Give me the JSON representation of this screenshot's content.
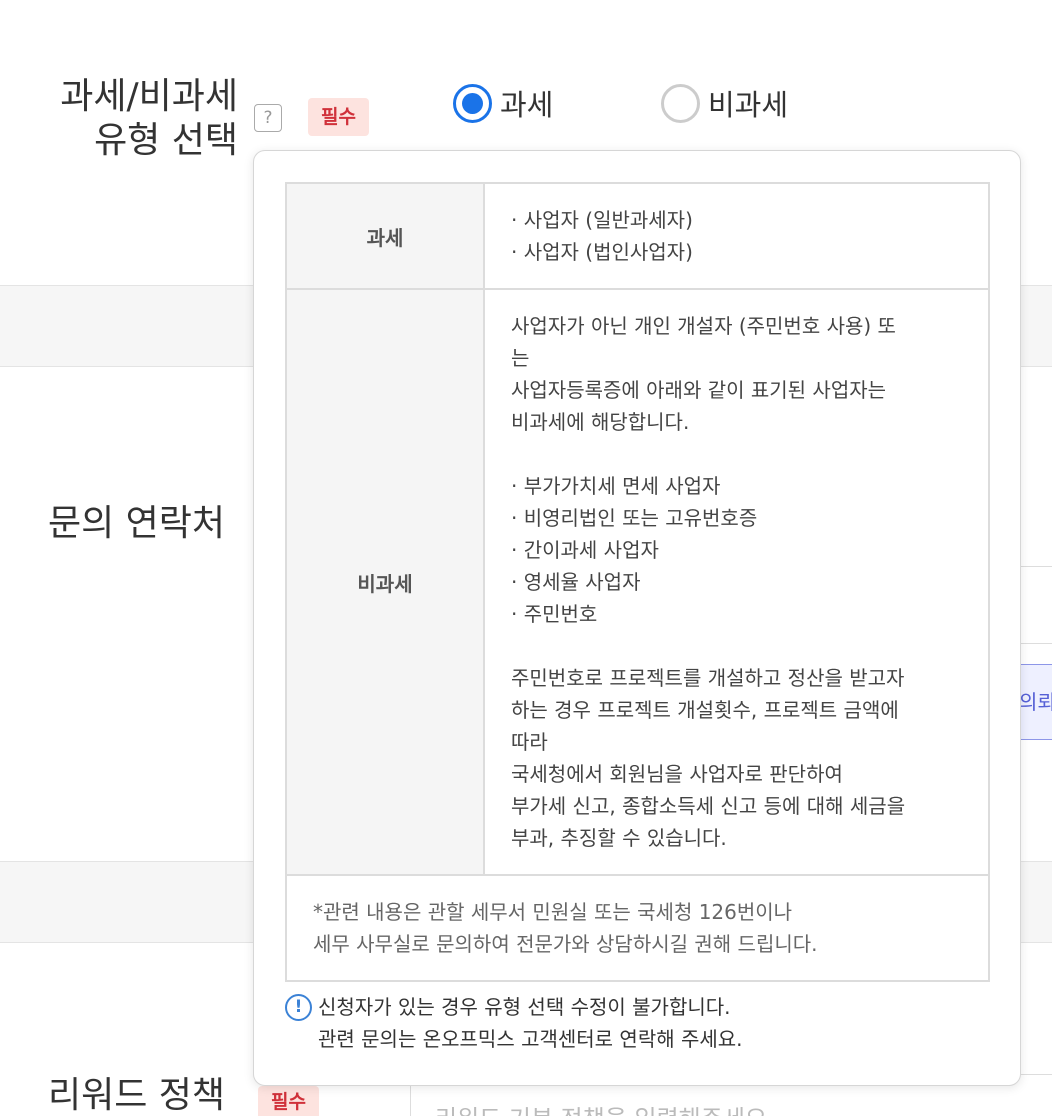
{
  "tax_section": {
    "label_line1": "과세/비과세",
    "label_line2": "유형 선택",
    "help_icon": "?",
    "required": "필수",
    "options": [
      {
        "label": "과세",
        "selected": true
      },
      {
        "label": "비과세",
        "selected": false
      }
    ]
  },
  "contact_section": {
    "label": "문의 연락처",
    "partial_button": "의뢰"
  },
  "reward_section": {
    "label": "리워드 정책",
    "required": "필수",
    "placeholder": "리워드 기본 정책을 입력해주세요"
  },
  "popover": {
    "rows": [
      {
        "header": "과세",
        "lines": [
          "· 사업자 (일반과세자)",
          "· 사업자 (법인사업자)"
        ]
      },
      {
        "header": "비과세",
        "intro": [
          "사업자가 아닌 개인 개설자 (주민번호 사용) 또",
          "는",
          "사업자등록증에 아래와 같이 표기된 사업자는",
          "비과세에 해당합니다."
        ],
        "items": [
          "· 부가가치세 면세 사업자",
          "· 비영리법인 또는 고유번호증",
          "· 간이과세 사업자",
          "· 영세율 사업자",
          "· 주민번호"
        ],
        "warning": [
          "주민번호로 프로젝트를 개설하고 정산을 받고자",
          "하는 경우 프로젝트 개설횟수, 프로젝트 금액에",
          "따라",
          "국세청에서 회원님을 사업자로 판단하여",
          "부가세 신고, 종합소득세 신고 등에 대해 세금을",
          "부과, 추징할 수 있습니다."
        ]
      }
    ],
    "note": [
      "*관련 내용은 관할 세무서 민원실 또는 국세청 126번이나",
      "세무 사무실로 문의하여 전문가와 상담하시길 권해 드립니다."
    ],
    "footer": {
      "icon": "!",
      "line1": "신청자가 있는 경우 유형 선택 수정이 불가합니다.",
      "line2": "관련 문의는 온오프믹스 고객센터로 연락해 주세요."
    }
  },
  "colors": {
    "accent": "#1a73e8",
    "required_bg": "#fde3df",
    "required_text": "#d0313a"
  }
}
